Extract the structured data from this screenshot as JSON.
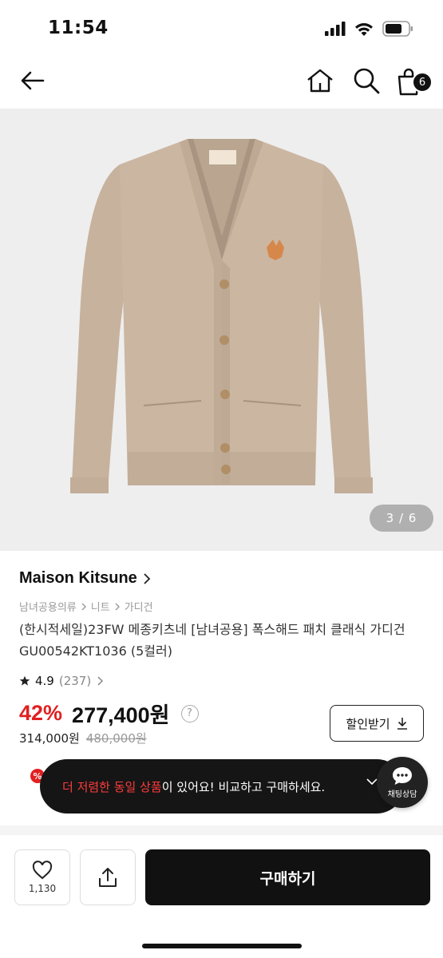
{
  "status_bar": {
    "time": "11:54"
  },
  "nav": {
    "cart_count": "6"
  },
  "gallery": {
    "counter": "3 / 6"
  },
  "product": {
    "brand": "Maison Kitsune",
    "breadcrumb": [
      "남녀공용의류",
      "니트",
      "가디건"
    ],
    "title": "(한시적세일)23FW 메종키츠네 [남녀공용] 폭스해드 패치 클래식 가디건 GU00542KT1036 (5컬러)",
    "rating": "4.9",
    "review_count": "(237)",
    "discount": "42%",
    "price": "277,400원",
    "help": "?",
    "original_price": "314,000원",
    "strike_price": "480,000원",
    "coupon_label": "할인받기"
  },
  "toast": {
    "highlight": "더 저렴한 동일 상품",
    "message": "이 있어요! 비교하고 구매하세요."
  },
  "chat": {
    "label": "채팅상담"
  },
  "bottom": {
    "like_count": "1,130",
    "buy_label": "구매하기"
  },
  "colors": {
    "discount_red": "#e02020",
    "sweater": "#c9b49f",
    "dark": "#111111"
  }
}
